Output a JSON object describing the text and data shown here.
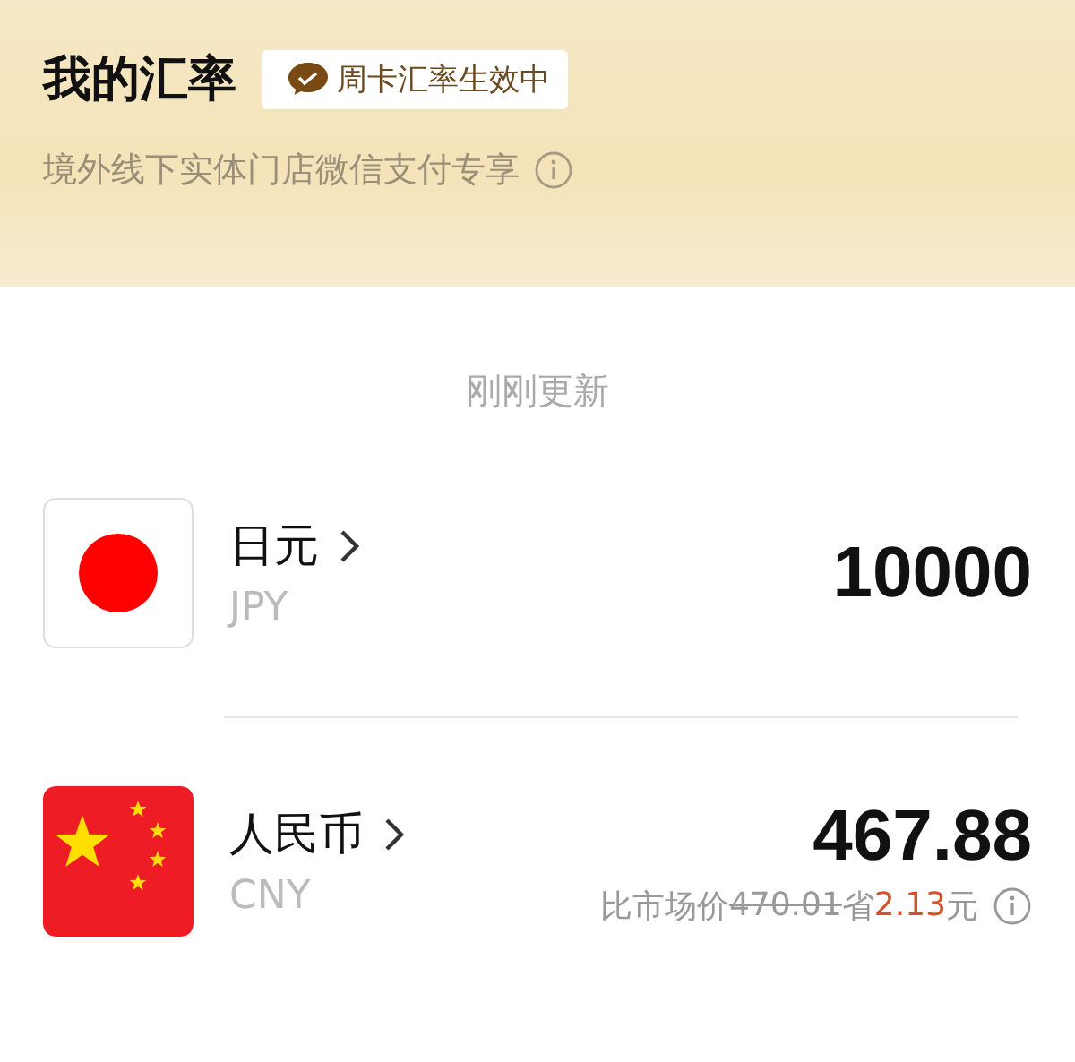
{
  "header": {
    "title": "我的汇率",
    "badge": "周卡汇率生效中",
    "subtitle": "境外线下实体门店微信支付专享"
  },
  "updated": "刚刚更新",
  "currencies": [
    {
      "kind": "jp",
      "name": "日元",
      "code": "JPY",
      "amount": "10000"
    },
    {
      "kind": "cn",
      "name": "人民币",
      "code": "CNY",
      "amount": "467.88",
      "comparison": {
        "label": "比市场价",
        "market_price": "470.01",
        "save_label": "省",
        "saving": "2.13",
        "unit": "元"
      }
    }
  ]
}
